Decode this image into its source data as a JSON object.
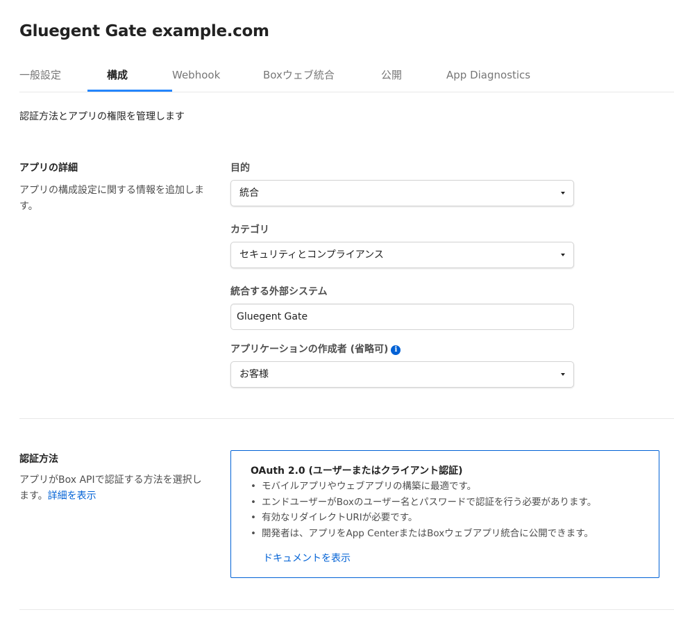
{
  "header": {
    "title": "Gluegent Gate example.com"
  },
  "tabs": [
    {
      "label": "一般設定"
    },
    {
      "label": "構成"
    },
    {
      "label": "Webhook"
    },
    {
      "label": "Boxウェブ統合"
    },
    {
      "label": "公開"
    },
    {
      "label": "App Diagnostics"
    }
  ],
  "active_tab": "構成",
  "page": {
    "subtitle": "認証方法とアプリの権限を管理します"
  },
  "app_details": {
    "title": "アプリの詳細",
    "description": "アプリの構成設定に関する情報を追加します。",
    "purpose": {
      "label": "目的",
      "value": "統合"
    },
    "category": {
      "label": "カテゴリ",
      "value": "セキュリティとコンプライアンス"
    },
    "external_system": {
      "label": "統合する外部システム",
      "value": "Gluegent Gate"
    },
    "creator": {
      "label": "アプリケーションの作成者 (省略可)",
      "value": "お客様",
      "info_icon": "info-icon"
    }
  },
  "auth": {
    "title": "認証方法",
    "description": "アプリがBox APIで認証する方法を選択します。",
    "details_link": "詳細を表示",
    "card": {
      "title": "OAuth 2.0 (ユーザーまたはクライアント認証)",
      "bullets": [
        "モバイルアプリやウェブアプリの構築に最適です。",
        "エンドユーザーがBoxのユーザー名とパスワードで認証を行う必要があります。",
        "有効なリダイレクトURIが必要です。",
        "開発者は、アプリをApp CenterまたはBoxウェブアプリ統合に公開できます。"
      ],
      "doc_link": "ドキュメントを表示"
    }
  },
  "colors": {
    "accent": "#2486fc",
    "link": "#0061d5"
  }
}
